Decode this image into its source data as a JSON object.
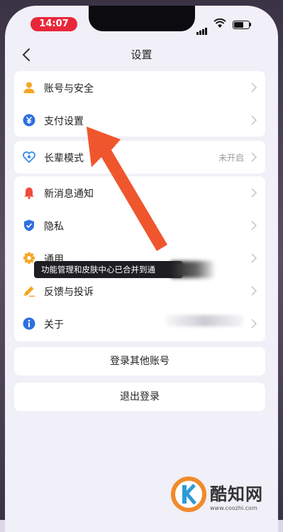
{
  "status_bar": {
    "time": "14:07"
  },
  "nav": {
    "title": "设置"
  },
  "groups": [
    {
      "items": [
        {
          "label": "账号与安全",
          "icon": "person-icon",
          "color": "#f5a623"
        },
        {
          "label": "支付设置",
          "icon": "yuan-icon",
          "color": "#2f6fe0"
        }
      ]
    },
    {
      "items": [
        {
          "label": "长辈模式",
          "icon": "heart-icon",
          "color": "#3a8ee6",
          "value": "未开启"
        }
      ]
    },
    {
      "items": [
        {
          "label": "新消息通知",
          "icon": "bell-icon",
          "color": "#ef4b3b"
        },
        {
          "label": "隐私",
          "icon": "shield-icon",
          "color": "#2f6fe0"
        },
        {
          "label": "通用",
          "icon": "gear-icon",
          "color": "#f5a623"
        },
        {
          "label": "反馈与投诉",
          "icon": "pencil-icon",
          "color": "#f5a623"
        },
        {
          "label": "关于",
          "icon": "info-icon",
          "color": "#2f6fe0"
        }
      ]
    }
  ],
  "tooltip": {
    "text": "功能管理和皮肤中心已合并到通"
  },
  "buttons": {
    "switch_account": "登录其他账号",
    "logout": "退出登录"
  },
  "watermark": {
    "brand": "酷知网",
    "url": "www.coozhi.com"
  },
  "colors": {
    "arrow": "#f0562e",
    "status_pill": "#e8283a"
  }
}
